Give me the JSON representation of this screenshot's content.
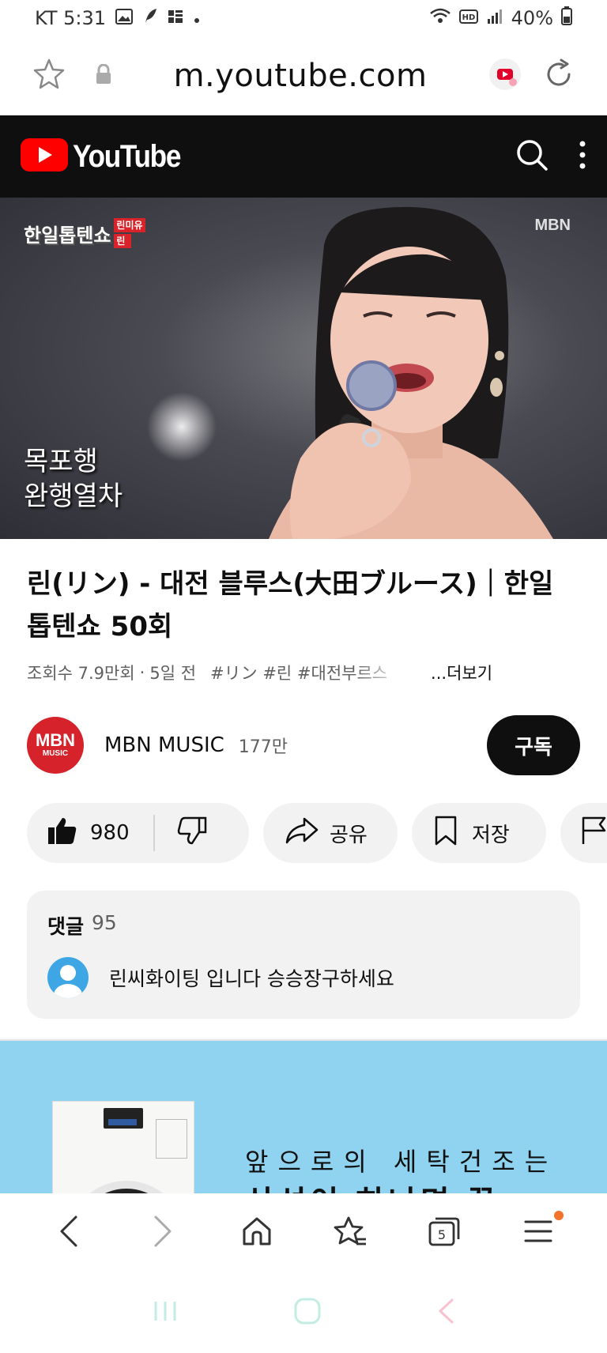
{
  "status_bar": {
    "carrier_time": "KT 5:31",
    "battery": "40%"
  },
  "browser": {
    "url": "m.youtube.com"
  },
  "youtube": {
    "logo_text": "YouTube"
  },
  "video": {
    "show_logo": "한일톱텐쇼",
    "show_tag_top": "린미유",
    "show_tag_bottom": "린",
    "broadcaster": "MBN",
    "caption_line1": "목포행",
    "caption_line2": "완행열차"
  },
  "title": "린(リン) - 대전 블루스(大田ブルース)｜한일 톱텐쇼 50회",
  "meta": {
    "views": "조회수 7.9만회",
    "separator": "·",
    "age": "5일 전",
    "tags": "#リン #린 #대전부르스",
    "more": "...더보기"
  },
  "channel": {
    "avatar_top": "MBN",
    "avatar_bottom": "MUSIC",
    "name": "MBN MUSIC",
    "subscribers": "177만",
    "subscribe_label": "구독"
  },
  "actions": {
    "like_count": "980",
    "share_label": "공유",
    "save_label": "저장"
  },
  "comments": {
    "label": "댓글",
    "count": "95",
    "top_comment": "린씨화이팅 입니다 승승장구하세요"
  },
  "ad": {
    "line1": "앞으로의 세탁건조는",
    "line2": "삼성이 하나면 끝"
  },
  "toolbar": {
    "tab_count": "5"
  },
  "colors": {
    "youtube_red": "#ff0000",
    "header_bg": "#0f0f0f",
    "pill_bg": "#f2f2f2",
    "ad_bg": "#8fd3f0",
    "notification_dot": "#f4722b"
  }
}
